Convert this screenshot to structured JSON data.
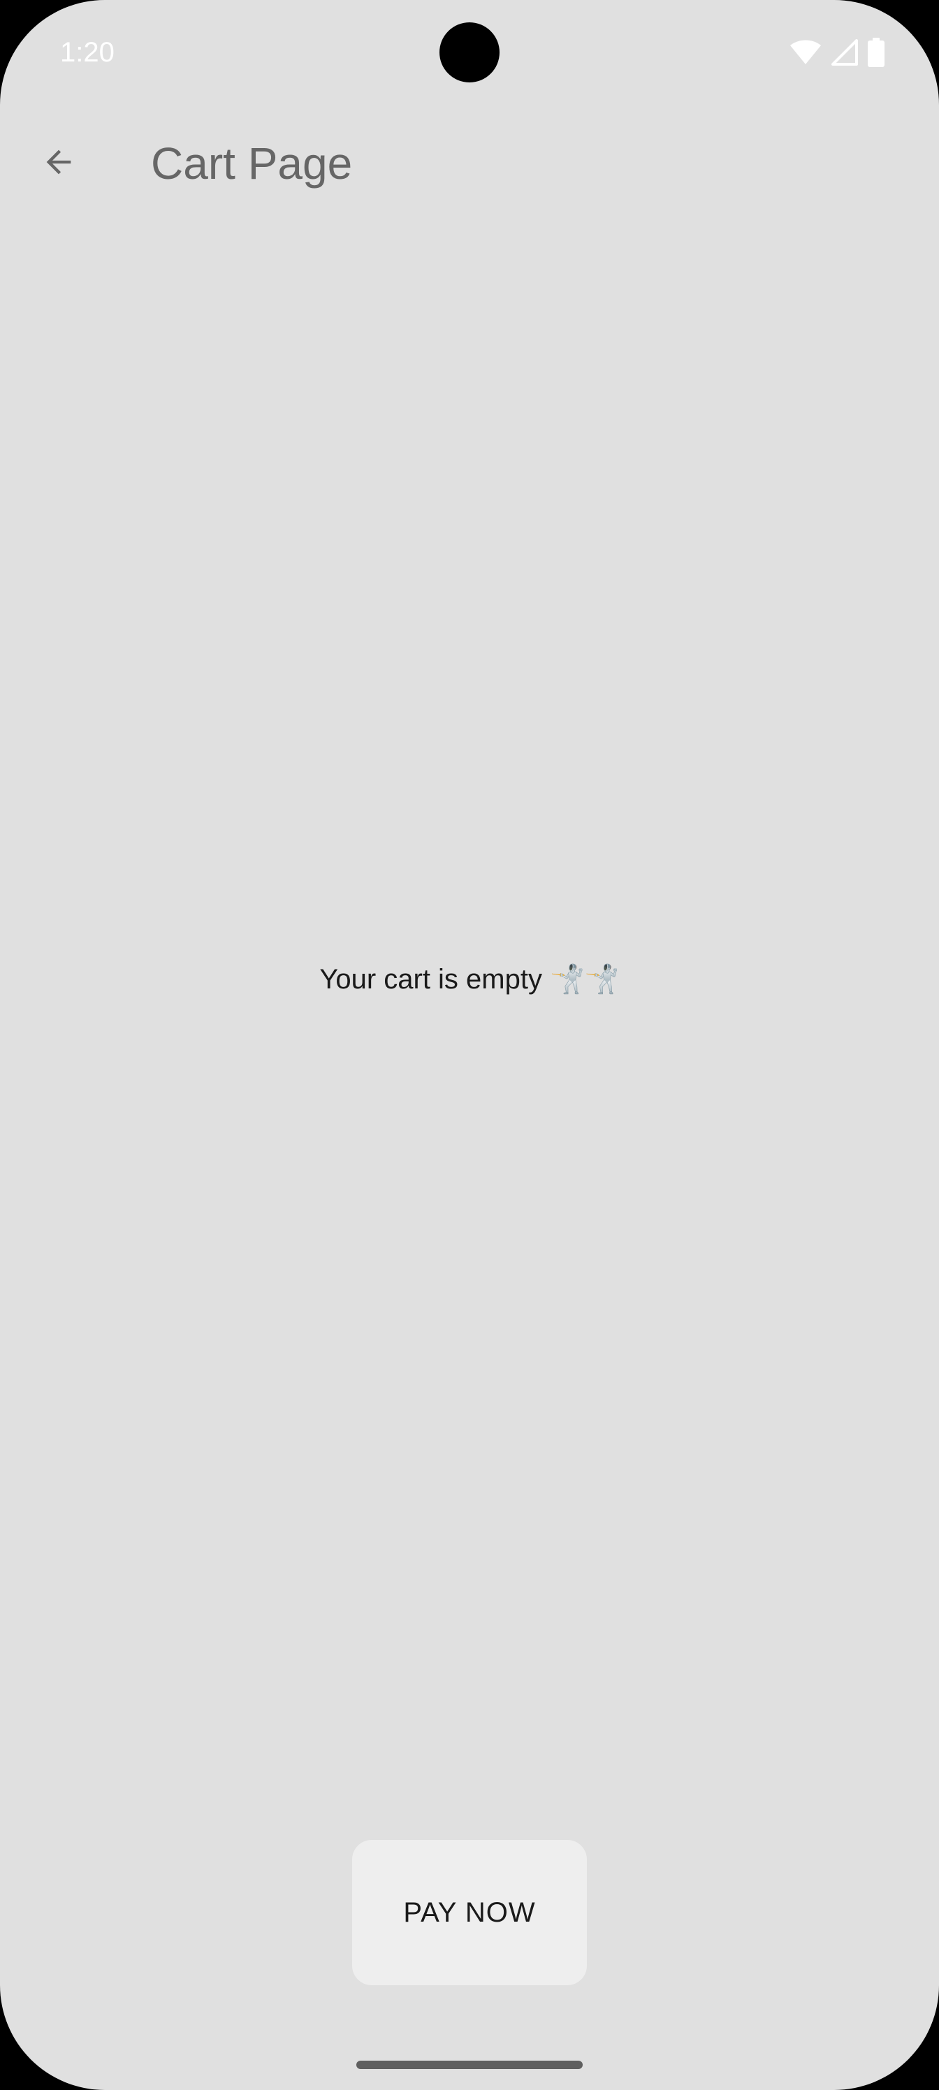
{
  "status_bar": {
    "time": "1:20",
    "icons": [
      "wifi-icon",
      "cellular-signal-icon",
      "battery-icon"
    ]
  },
  "app_bar": {
    "back_icon": "arrow-back-icon",
    "title": "Cart Page"
  },
  "content": {
    "empty_message": "Your cart is empty 🤺🤺"
  },
  "actions": {
    "pay_label": "PAY NOW"
  },
  "colors": {
    "background": "#e0e0e0",
    "title_text": "#666666",
    "button_background": "#eeeeee",
    "status_text": "#ffffff"
  }
}
